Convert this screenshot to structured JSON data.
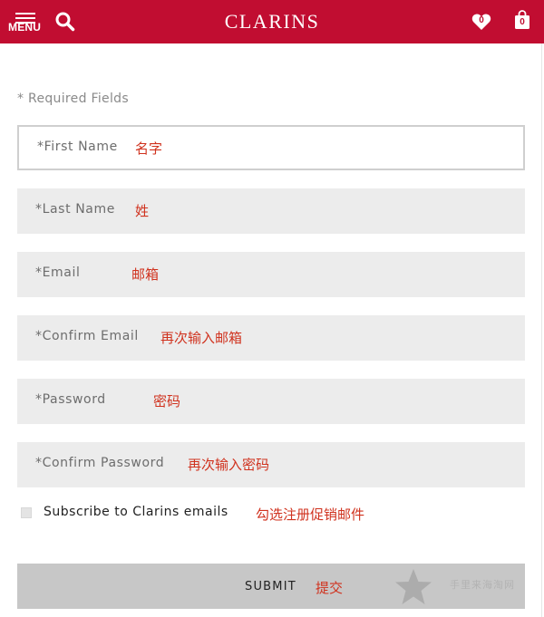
{
  "header": {
    "menu_label": "MENU",
    "logo": "CLARINS",
    "wishlist_count": "0",
    "bag_count": "0",
    "background_color": "#c10d31"
  },
  "form": {
    "required_note": "* Required Fields",
    "fields": [
      {
        "label": "*First Name",
        "annotation": "名字"
      },
      {
        "label": "*Last Name",
        "annotation": "姓"
      },
      {
        "label": "*Email",
        "annotation": "邮箱"
      },
      {
        "label": "*Confirm Email",
        "annotation": "再次输入邮箱"
      },
      {
        "label": "*Password",
        "annotation": "密码"
      },
      {
        "label": "*Confirm Password",
        "annotation": "再次输入密码"
      }
    ],
    "subscribe_label": "Subscribe to Clarins emails",
    "subscribe_annotation": "勾选注册促销邮件",
    "submit_label": "SUBMIT",
    "submit_annotation": "提交"
  },
  "watermark": {
    "text": "手里来海淘网"
  },
  "icons": [
    "menu-icon",
    "search-icon",
    "heart-icon",
    "shopping-bag-icon",
    "watermark-star-icon"
  ],
  "colors": {
    "brand_red": "#c10d31",
    "annotation_red": "#d0321e",
    "field_bg": "#ececec",
    "submit_bg": "#c7c7c7"
  }
}
